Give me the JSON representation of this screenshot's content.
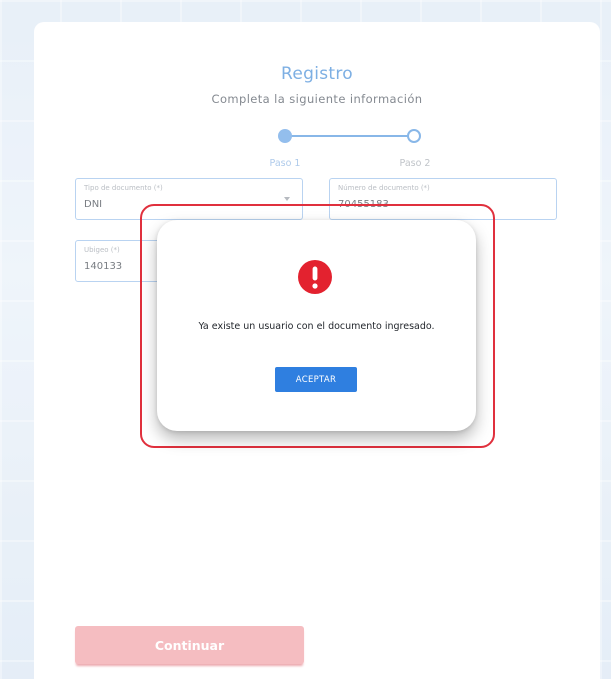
{
  "form": {
    "title": "Registro",
    "subtitle": "Completa la siguiente información",
    "steps": [
      {
        "label": "Paso 1"
      },
      {
        "label": "Paso 2"
      }
    ],
    "fields": {
      "document_type": {
        "label": "Tipo de documento (*)",
        "value": "DNI"
      },
      "document_number": {
        "label": "Número de documento (*)",
        "value": "70455183"
      },
      "ubigeo": {
        "label": "Ubigeo (*)",
        "value": "140133"
      }
    },
    "continue_label": "Continuar"
  },
  "modal": {
    "icon": "exclamation-circle-icon",
    "message": "Ya existe un usuario con el documento ingresado.",
    "accept_label": "ACEPTAR"
  },
  "colors": {
    "primary": "#2f7fe0",
    "accent_light": "#4b90d9",
    "error": "#e3222f",
    "continue_button": "#f2a4aa"
  }
}
